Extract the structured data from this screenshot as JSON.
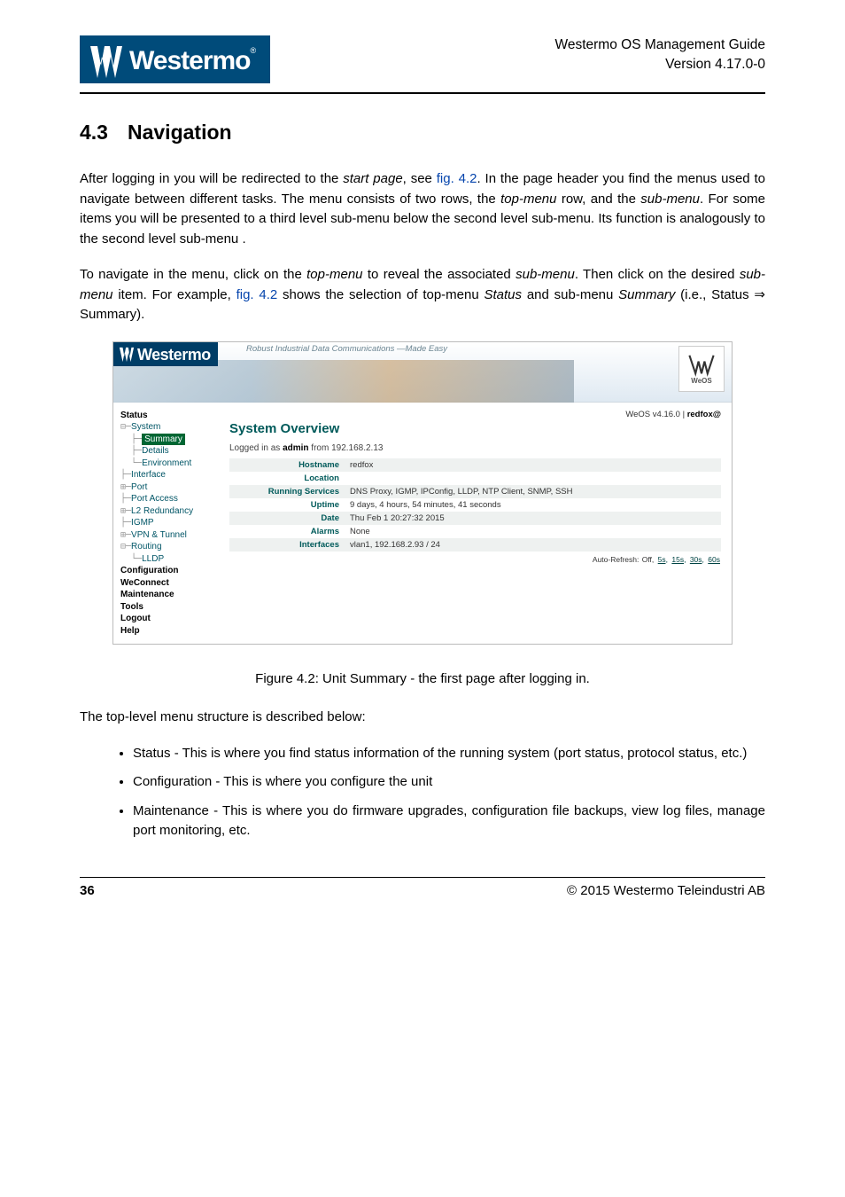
{
  "header": {
    "logo_text": "Westermo",
    "title_line1": "Westermo OS Management Guide",
    "title_line2": "Version 4.17.0-0"
  },
  "section": {
    "number": "4.3",
    "title": "Navigation"
  },
  "para1_a": "After logging in you will be redirected to the ",
  "para1_start": "start page",
  "para1_b": ", see ",
  "para1_link1": "fig. 4.2",
  "para1_c": ". In the page header you find the menus used to navigate between different tasks. The menu consists of two rows, the ",
  "para1_top": "top-menu",
  "para1_d": " row, and the ",
  "para1_sub": "sub-menu",
  "para1_e": ". For some items you will be presented to a third level sub-menu below the second level sub-menu. Its function is analogously to the second level sub-menu .",
  "para2_a": "To navigate in the menu, click on the ",
  "para2_top": "top-menu",
  "para2_b": " to reveal the associated ",
  "para2_sub1": "sub-menu",
  "para2_c": ". Then click on the desired ",
  "para2_sub2": "sub-menu",
  "para2_d": " item. For example, ",
  "para2_link": "fig. 4.2",
  "para2_e": " shows the selection of top-menu ",
  "para2_status": "Status",
  "para2_f": " and sub-menu ",
  "para2_summary": "Summary",
  "para2_g": " (i.e., Status ⇒ Summary).",
  "shot": {
    "logo_text": "Westermo",
    "tagline": "Robust Industrial Data Communications —Made Easy",
    "weos_label": "WeOS",
    "status_line": {
      "pre": "WeOS v4.16.0 | ",
      "host": "redfox@"
    },
    "heading": "System Overview",
    "login_a": "Logged in as ",
    "login_user": "admin",
    "login_b": " from 192.168.2.13",
    "nav": {
      "status": "Status",
      "system": "System",
      "summary": "Summary",
      "details": "Details",
      "environment": "Environment",
      "interface": "Interface",
      "port": "Port",
      "port_access": "Port Access",
      "l2red": "L2 Redundancy",
      "igmp": "IGMP",
      "vpn": "VPN & Tunnel",
      "routing": "Routing",
      "lldp": "LLDP",
      "configuration": "Configuration",
      "weconnect": "WeConnect",
      "maintenance": "Maintenance",
      "tools": "Tools",
      "logout": "Logout",
      "help": "Help"
    },
    "rows": {
      "hostname_k": "Hostname",
      "hostname_v": "redfox",
      "location_k": "Location",
      "location_v": "",
      "services_k": "Running Services",
      "services_v": "DNS Proxy, IGMP, IPConfig, LLDP, NTP Client, SNMP, SSH",
      "uptime_k": "Uptime",
      "uptime_v": "9 days, 4 hours, 54 minutes, 41 seconds",
      "date_k": "Date",
      "date_v": "Thu Feb 1 20:27:32 2015",
      "alarms_k": "Alarms",
      "alarms_v": "None",
      "interfaces_k": "Interfaces",
      "interfaces_v": "vlan1, 192.168.2.93 / 24"
    },
    "refresh_label": "Auto-Refresh:",
    "refresh_off": "Off,",
    "refresh_5s": "5s,",
    "refresh_15s": "15s,",
    "refresh_30s": "30s,",
    "refresh_60s": "60s"
  },
  "figure_caption": "Figure 4.2: Unit Summary - the first page after logging in.",
  "list_intro": "The top-level menu structure is described below:",
  "bullets": {
    "b1": "Status - This is where you find status information of the running system (port status, protocol status, etc.)",
    "b2": "Configuration - This is where you configure the unit",
    "b3": "Maintenance - This is where you do firmware upgrades, configuration file backups, view log files, manage port monitoring, etc."
  },
  "footer": {
    "page": "36",
    "copyright": "© 2015 Westermo Teleindustri AB"
  }
}
